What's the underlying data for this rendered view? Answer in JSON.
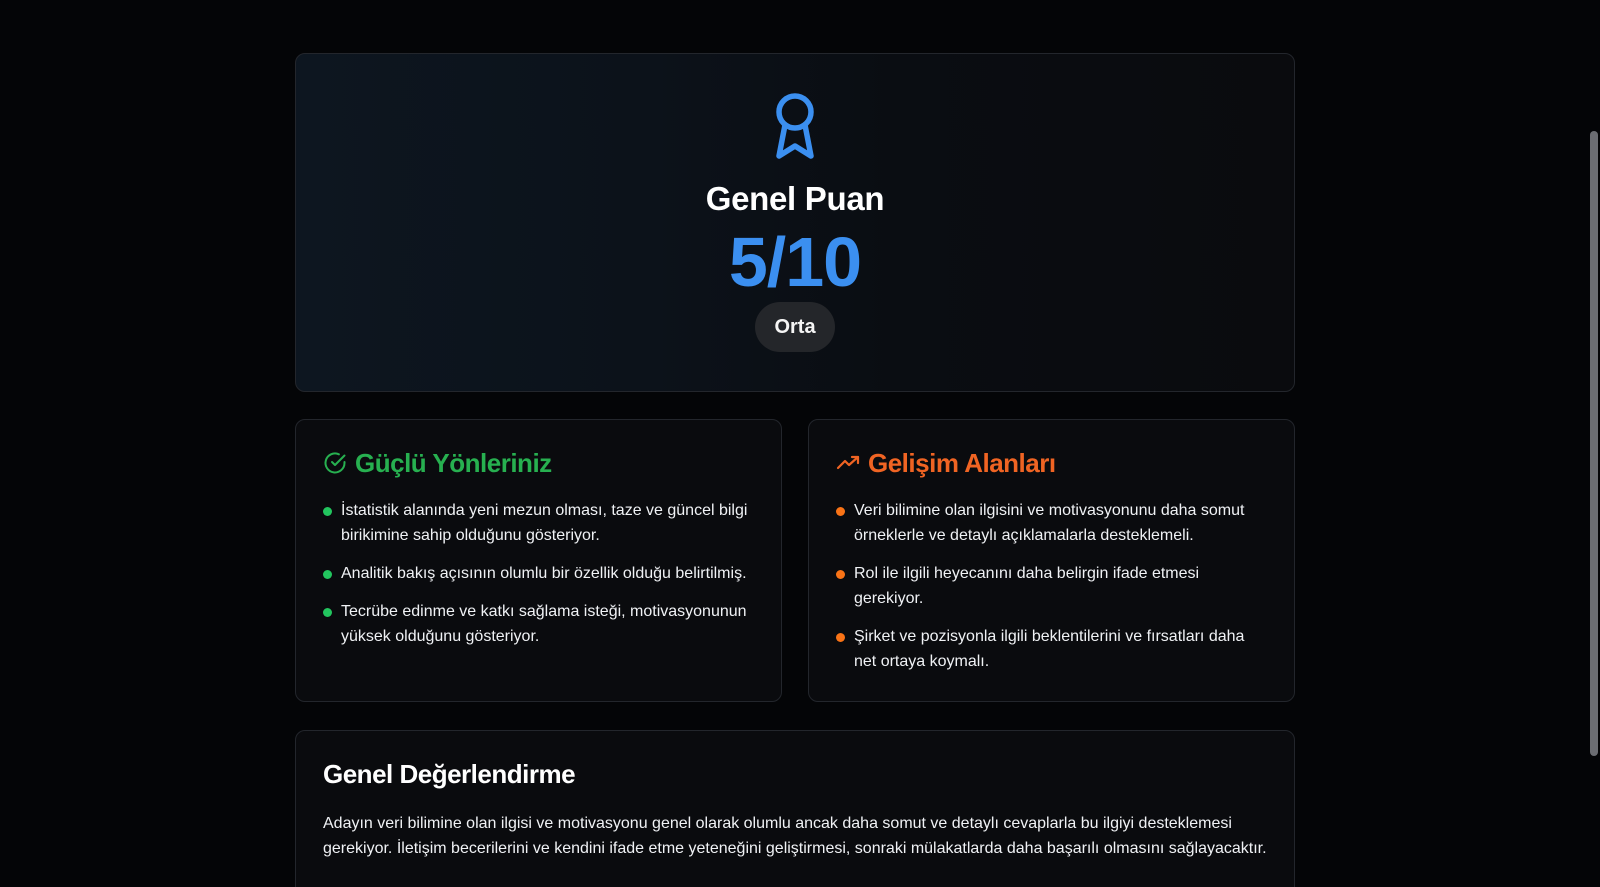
{
  "score": {
    "title": "Genel Puan",
    "value": "5/10",
    "level": "Orta",
    "icon": "award-icon",
    "accent_color": "#3b8ff0"
  },
  "strengths": {
    "title": "Güçlü Yönleriniz",
    "icon": "check-circle-icon",
    "color": "#27b050",
    "items": [
      "İstatistik alanında yeni mezun olması, taze ve güncel bilgi birikimine sahip olduğunu gösteriyor.",
      "Analitik bakış açısının olumlu bir özellik olduğu belirtilmiş.",
      "Tecrübe edinme ve katkı sağlama isteği, motivasyonunun yüksek olduğunu gösteriyor."
    ]
  },
  "improvements": {
    "title": "Gelişim Alanları",
    "icon": "trending-up-icon",
    "color": "#f06423",
    "items": [
      "Veri bilimine olan ilgisini ve motivasyonunu daha somut örneklerle ve detaylı açıklamalarla desteklemeli.",
      "Rol ile ilgili heyecanını daha belirgin ifade etmesi gerekiyor.",
      "Şirket ve pozisyonla ilgili beklentilerini ve fırsatları daha net ortaya koymalı."
    ]
  },
  "general": {
    "title": "Genel Değerlendirme",
    "text": "Adayın veri bilimine olan ilgisi ve motivasyonu genel olarak olumlu ancak daha somut ve detaylı cevaplarla bu ilgiyi desteklemesi gerekiyor. İletişim becerilerini ve kendini ifade etme yeteneğini geliştirmesi, sonraki mülakatlarda daha başarılı olmasını sağlayacaktır."
  }
}
